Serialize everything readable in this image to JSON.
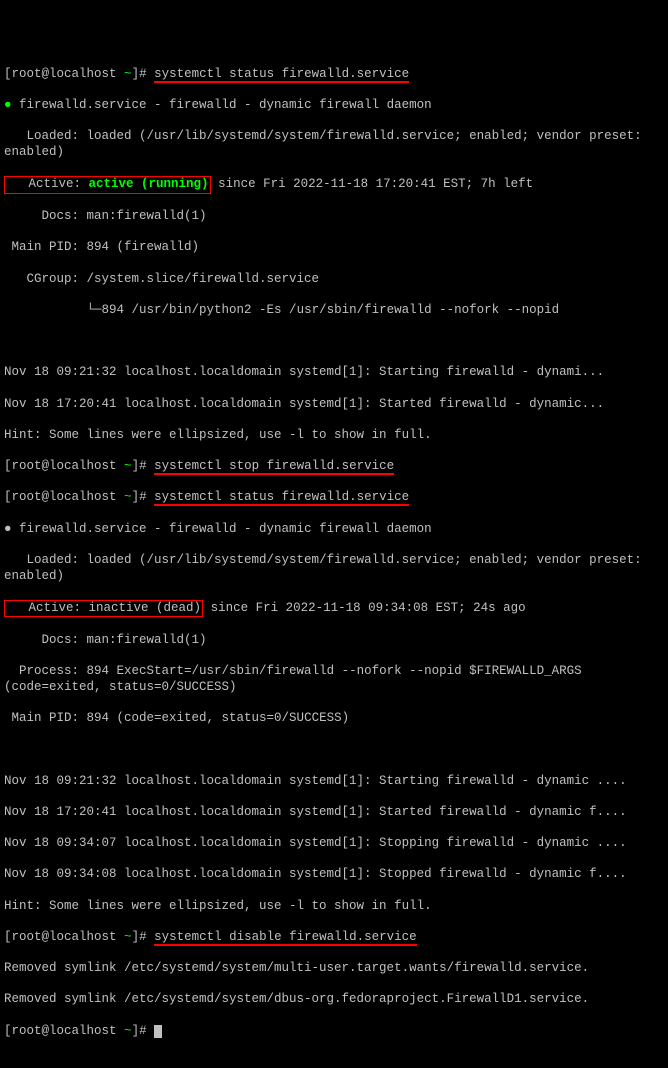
{
  "prompt": {
    "open_bracket": "[",
    "user_host": "root@localhost ",
    "tilde": "~",
    "close_bracket": "]# "
  },
  "cmd1": "systemctl status firewalld.service",
  "cmd2": "systemctl stop firewalld.service",
  "cmd3": "systemctl status firewalld.service",
  "cmd4": "systemctl disable firewalld.service",
  "status1": {
    "dot": "●",
    "title": " firewalld.service - firewalld - dynamic firewall daemon",
    "loaded": "   Loaded: loaded (/usr/lib/systemd/system/firewalld.service; enabled; vendor preset: enabled)",
    "active_label": "   Active: ",
    "active_value": "active (running)",
    "active_rest": " since Fri 2022-11-18 17:20:41 EST; 7h left",
    "docs": "     Docs: man:firewalld(1)",
    "pid": " Main PID: 894 (firewalld)",
    "cgroup1": "   CGroup: /system.slice/firewalld.service",
    "cgroup2_prefix": "           └─",
    "cgroup2": "894 /usr/bin/python2 -Es /usr/sbin/firewalld --nofork --nopid"
  },
  "log1": {
    "l1": "Nov 18 09:21:32 localhost.localdomain systemd[1]: Starting firewalld - dynami...",
    "l2": "Nov 18 17:20:41 localhost.localdomain systemd[1]: Started firewalld - dynamic...",
    "hint": "Hint: Some lines were ellipsized, use -l to show in full."
  },
  "status2": {
    "dot": "●",
    "title": " firewalld.service - firewalld - dynamic firewall daemon",
    "loaded": "   Loaded: loaded (/usr/lib/systemd/system/firewalld.service; enabled; vendor preset: enabled)",
    "active_label": "   Active: ",
    "active_value": "inactive (dead)",
    "active_rest": " since Fri 2022-11-18 09:34:08 EST; 24s ago",
    "docs": "     Docs: man:firewalld(1)",
    "process": "  Process: 894 ExecStart=/usr/sbin/firewalld --nofork --nopid $FIREWALLD_ARGS (code=exited, status=0/SUCCESS)",
    "pid": " Main PID: 894 (code=exited, status=0/SUCCESS)"
  },
  "log2": {
    "l1": "Nov 18 09:21:32 localhost.localdomain systemd[1]: Starting firewalld - dynamic ....",
    "l2": "Nov 18 17:20:41 localhost.localdomain systemd[1]: Started firewalld - dynamic f....",
    "l3": "Nov 18 09:34:07 localhost.localdomain systemd[1]: Stopping firewalld - dynamic ....",
    "l4": "Nov 18 09:34:08 localhost.localdomain systemd[1]: Stopped firewalld - dynamic f....",
    "hint": "Hint: Some lines were ellipsized, use -l to show in full."
  },
  "rm1": "Removed symlink /etc/systemd/system/multi-user.target.wants/firewalld.service.",
  "rm2": "Removed symlink /etc/systemd/system/dbus-org.fedoraproject.FirewallD1.service."
}
